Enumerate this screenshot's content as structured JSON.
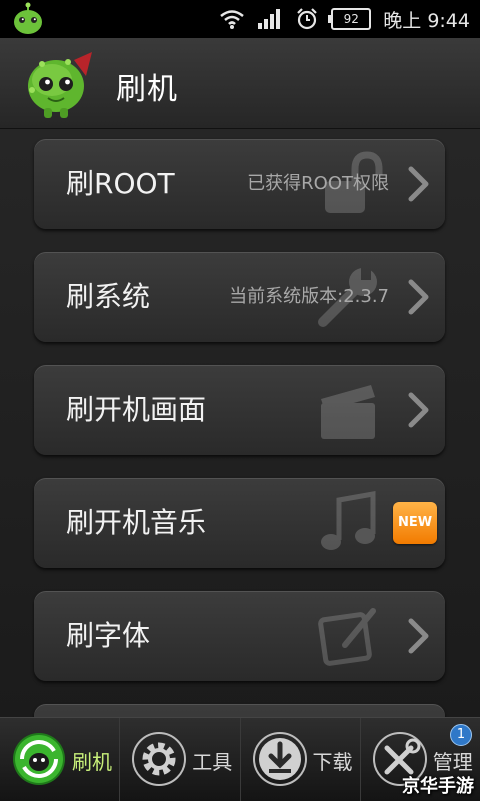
{
  "status_bar": {
    "time": "晚上 9:44",
    "battery": "92",
    "icons": [
      "wifi-icon",
      "signal-icon",
      "alarm-icon",
      "battery-icon"
    ]
  },
  "header": {
    "title": "刷机",
    "logo": "android-robot-logo"
  },
  "menu": [
    {
      "title": "刷ROOT",
      "subtitle": "已获得ROOT权限",
      "icon": "unlock-icon",
      "indicator": "chevron"
    },
    {
      "title": "刷系统",
      "subtitle": "当前系统版本:2.3.7",
      "icon": "wrench-icon",
      "indicator": "chevron"
    },
    {
      "title": "刷开机画面",
      "subtitle": "",
      "icon": "clapperboard-icon",
      "indicator": "chevron"
    },
    {
      "title": "刷开机音乐",
      "subtitle": "",
      "icon": "music-note-icon",
      "indicator": "new-badge",
      "badge": "NEW"
    },
    {
      "title": "刷字体",
      "subtitle": "",
      "icon": "edit-icon",
      "indicator": "chevron"
    }
  ],
  "tabs": [
    {
      "label": "刷机",
      "icon": "android-refresh-icon",
      "active": true
    },
    {
      "label": "工具",
      "icon": "gear-icon",
      "active": false
    },
    {
      "label": "下载",
      "icon": "download-icon",
      "active": false
    },
    {
      "label": "管理",
      "icon": "tools-icon",
      "active": false,
      "badge": "1"
    }
  ],
  "watermark": "京华手游",
  "colors": {
    "accent_green": "#7bd23a",
    "badge_orange": "#f27b00",
    "badge_blue": "#2f78c8"
  }
}
